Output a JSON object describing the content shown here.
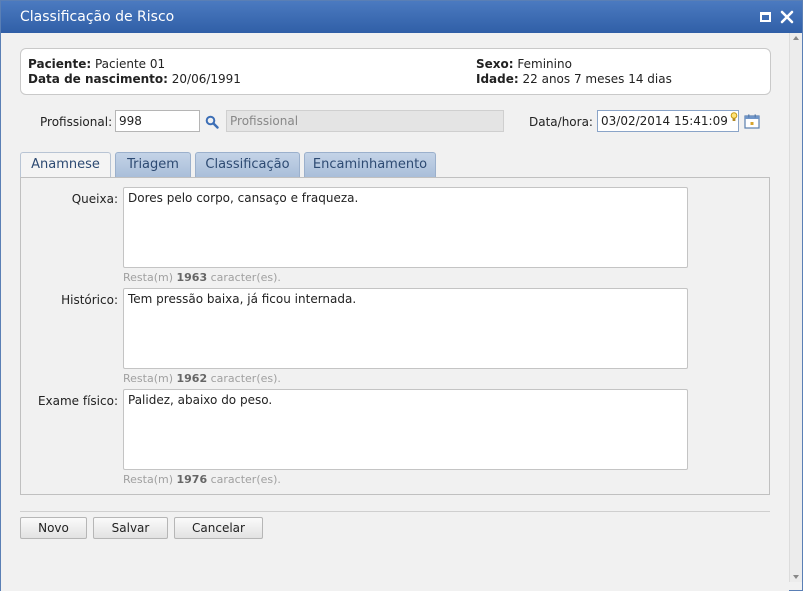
{
  "window": {
    "title": "Classificação de Risco"
  },
  "patient": {
    "name_label": "Paciente:",
    "name_value": "Paciente 01",
    "birth_label": "Data de nascimento:",
    "birth_value": "20/06/1991",
    "sex_label": "Sexo:",
    "sex_value": "Feminino",
    "age_label": "Idade:",
    "age_value": "22 anos 7 meses 14 dias"
  },
  "form": {
    "professional_label": "Profissional:",
    "professional_code": "998",
    "professional_name_placeholder": "Profissional",
    "datetime_label": "Data/hora:",
    "datetime_value": "03/02/2014 15:41:09"
  },
  "tabs": [
    {
      "label": "Anamnese",
      "active": true
    },
    {
      "label": "Triagem",
      "active": false
    },
    {
      "label": "Classificação",
      "active": false
    },
    {
      "label": "Encaminhamento",
      "active": false
    }
  ],
  "anamnese": {
    "fields": [
      {
        "label": "Queixa:",
        "value": "Dores pelo corpo, cansaço e fraqueza.",
        "counter_prefix": "Resta(m)",
        "remaining": "1963",
        "counter_suffix": "caracter(es)."
      },
      {
        "label": "Histórico:",
        "value": "Tem pressão baixa, já ficou internada.",
        "counter_prefix": "Resta(m)",
        "remaining": "1962",
        "counter_suffix": "caracter(es)."
      },
      {
        "label": "Exame físico:",
        "value": "Palidez, abaixo do peso.",
        "counter_prefix": "Resta(m)",
        "remaining": "1976",
        "counter_suffix": "caracter(es)."
      }
    ]
  },
  "buttons": {
    "new": "Novo",
    "save": "Salvar",
    "cancel": "Cancelar"
  },
  "icons": {
    "title_controls": [
      "maximize-icon",
      "close-icon"
    ],
    "lookup": "search-icon",
    "date": "calendar-icon"
  },
  "colors": {
    "titlebar": "#3a69b2",
    "tab_text": "#2d4a72"
  }
}
